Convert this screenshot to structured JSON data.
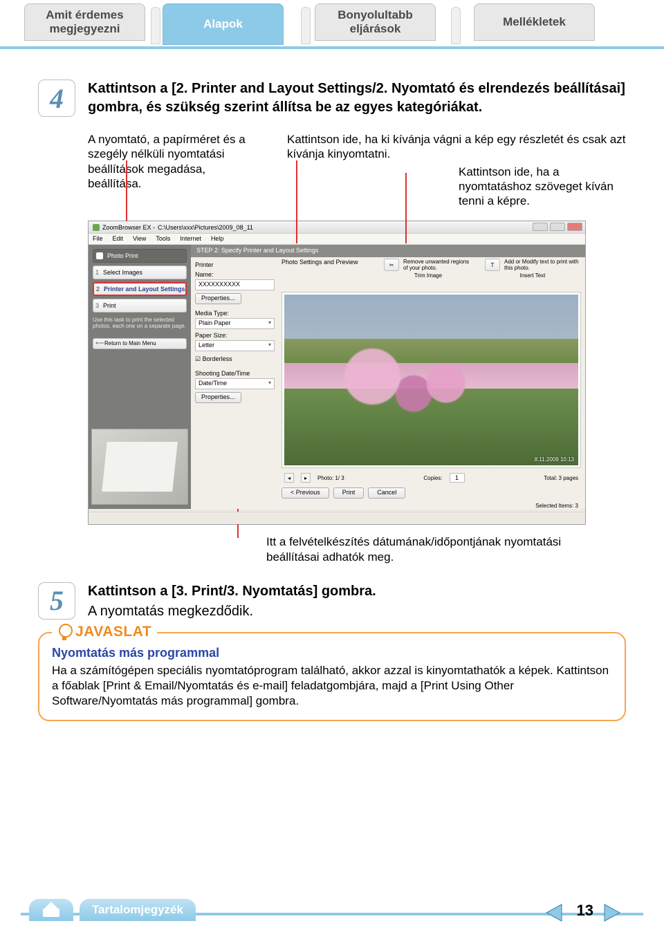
{
  "tabs": {
    "t1": "Amit érdemes\nmegjegyezni",
    "t2": "Alapok",
    "t3": "Bonyolultabb\neljárások",
    "t4": "Mellékletek"
  },
  "step4": {
    "num": "4",
    "title_bold": "Kattintson a [2. Printer and Layout Settings/2. Nyomtató és elrendezés beállításai] gombra, és szükség szerint állítsa be az egyes kategóriákat.",
    "callout_left": "A nyomtató, a papírméret és a szegély nélküli nyomtatási beállítások megadása, beállítása.",
    "callout_right1": "Kattintson ide, ha ki kívánja vágni a kép egy részletét és csak azt kívánja kinyomtatni.",
    "callout_right2": "Kattintson ide, ha a nyomtatáshoz szöveget kíván tenni a képre."
  },
  "zb": {
    "title_app": "ZoomBrowser EX  -",
    "title_path": "C:\\Users\\xxx\\Pictures\\2009_08_11",
    "menu": [
      "File",
      "Edit",
      "View",
      "Tools",
      "Internet",
      "Help"
    ],
    "sidebar": {
      "header": "Photo Print",
      "items": [
        {
          "num": "1",
          "label": "Select Images"
        },
        {
          "num": "2",
          "label": "Printer and Layout Settings"
        },
        {
          "num": "3",
          "label": "Print"
        }
      ],
      "note": "Use this task to print the selected photos, each one on a separate page.",
      "return": "Return to Main Menu"
    },
    "stepbar": "STEP 2: Specify Printer and Layout Settings",
    "labels": {
      "printer": "Printer",
      "name": "Name:",
      "name_val": "XXXXXXXXXX",
      "properties": "Properties...",
      "media": "Media Type:",
      "media_val": "Plain Paper",
      "paper": "Paper Size:",
      "paper_val": "Letter",
      "borderless": "Borderless",
      "shooting": "Shooting Date/Time",
      "dt_val": "Date/Time"
    },
    "preview": {
      "header": "Photo Settings and Preview",
      "trim_desc": "Remove unwanted regions of your photo.",
      "trim_label": "Trim Image",
      "text_desc": "Add or Modify text to print with this photo.",
      "text_label": "Insert Text",
      "timestamp": "8.11.2009    10:13",
      "photo_count": "Photo: 1/ 3",
      "copies": "Copies:",
      "copies_val": "1",
      "total": "Total: 3 pages",
      "prev": "< Previous",
      "print": "Print",
      "cancel": "Cancel",
      "selected": "Selected Items: 3"
    }
  },
  "shot_caption": "Itt a felvételkészítés dátumának/időpontjának nyomtatási beállításai adhatók meg.",
  "step5": {
    "num": "5",
    "title_bold": "Kattintson a [3. Print/3. Nyomtatás] gombra.",
    "sub": "A nyomtatás megkezdődik."
  },
  "tip": {
    "heading": "JAVASLAT",
    "subtitle": "Nyomtatás más programmal",
    "body": "Ha a számítógépen speciális nyomtatóprogram található, akkor azzal is kinyomtathatók a képek. Kattintson a főablak [Print & Email/Nyomtatás és e-mail] feladatgombjára, majd a [Print Using Other Software/Nyomtatás más programmal] gombra."
  },
  "footer": {
    "toc": "Tartalomjegyzék",
    "page": "13"
  }
}
